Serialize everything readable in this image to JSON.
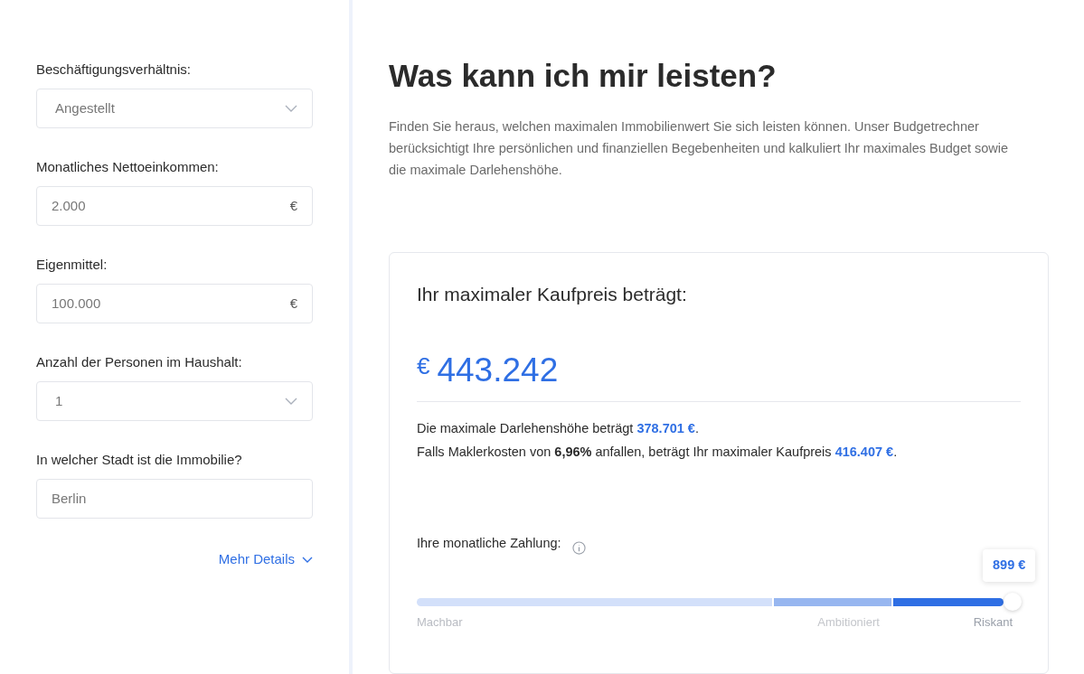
{
  "form": {
    "fields": [
      {
        "label": "Beschäftigungsverhältnis:",
        "kind": "select",
        "value": "Angestellt"
      },
      {
        "label": "Monatliches Nettoeinkommen:",
        "kind": "input",
        "value": "2.000",
        "unit": "€"
      },
      {
        "label": "Eigenmittel:",
        "kind": "input",
        "value": "100.000",
        "unit": "€"
      },
      {
        "label": "Anzahl der Personen im Haushalt:",
        "kind": "select",
        "value": "1"
      },
      {
        "label": "In welcher Stadt ist die Immobilie?",
        "kind": "input",
        "value": "Berlin"
      }
    ],
    "more_link": "Mehr Details"
  },
  "main": {
    "title": "Was kann ich mir leisten?",
    "intro": "Finden Sie heraus, welchen maximalen Immobilienwert Sie sich leisten können. Unser Budgetrechner berücksichtigt Ihre persönlichen und finanziellen Begebenheiten und kalkuliert Ihr maximales Budget sowie die maximale Darlehenshöhe.",
    "result": {
      "heading": "Ihr maximaler Kaufpreis beträgt:",
      "currency": "€",
      "amount": "443.242",
      "lines": [
        [
          {
            "text": "Die maximale Darlehenshöhe beträgt ",
            "kind": "plain"
          },
          {
            "text": "378.701 €",
            "kind": "amount"
          },
          {
            "text": ".",
            "kind": "plain"
          }
        ],
        [
          {
            "text": "Falls Maklerkosten von ",
            "kind": "plain"
          },
          {
            "text": "6,96%",
            "kind": "bold"
          },
          {
            "text": " anfallen, beträgt Ihr maximaler Kaufpreis ",
            "kind": "plain"
          },
          {
            "text": "416.407 €",
            "kind": "amount"
          },
          {
            "text": ".",
            "kind": "plain"
          }
        ]
      ],
      "payment": {
        "label": "Ihre monatliche Zahlung:",
        "value": "899 €",
        "level": 1,
        "zones": [
          {
            "label": "Machbar",
            "color": "#d3e0fa"
          },
          {
            "label": "Ambitioniert",
            "color": "#97b6f0"
          },
          {
            "label": "Riskant",
            "color": "#2f6fe4"
          }
        ]
      }
    }
  }
}
